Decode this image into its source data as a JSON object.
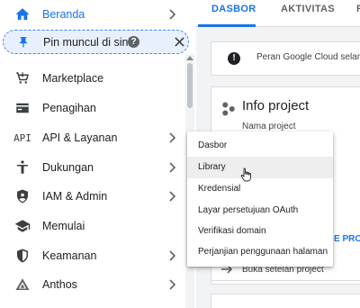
{
  "nav": {
    "items": [
      {
        "label": "Beranda",
        "icon": "home-icon"
      },
      {
        "label": "Marketplace",
        "icon": "cart-icon"
      },
      {
        "label": "Penagihan",
        "icon": "billing-icon"
      },
      {
        "label": "API & Layanan",
        "icon": "api-icon",
        "icon_text": "API"
      },
      {
        "label": "Dukungan",
        "icon": "support-person-icon"
      },
      {
        "label": "IAM & Admin",
        "icon": "shield-person-icon"
      },
      {
        "label": "Memulai",
        "icon": "graduation-cap-icon"
      },
      {
        "label": "Keamanan",
        "icon": "security-shield-icon"
      },
      {
        "label": "Anthos",
        "icon": "anthos-icon"
      }
    ],
    "pin": {
      "label": "Pin muncul di sini",
      "help_icon": "help-icon",
      "close_icon": "close-icon"
    }
  },
  "tabs": [
    {
      "label": "DASBOR",
      "active": true
    },
    {
      "label": "AKTIVITAS",
      "active": false
    },
    {
      "label": "R",
      "active": false
    }
  ],
  "banner": {
    "icon_text": "!",
    "text": "Peran Google Cloud selama"
  },
  "info_card": {
    "title": "Info project",
    "subtitle": "Nama project",
    "link": "E PROJ",
    "footer": "Buka setelan project"
  },
  "submenu": {
    "items": [
      {
        "label": "Dasbor"
      },
      {
        "label": "Library"
      },
      {
        "label": "Kredensial"
      },
      {
        "label": "Layar persetujuan OAuth"
      },
      {
        "label": "Verifikasi domain"
      },
      {
        "label": "Perjanjian penggunaan halaman"
      }
    ],
    "hovered_index": 1
  },
  "colors": {
    "accent": "#1a73e8",
    "pin_bg": "#e8f0fe",
    "content_bg": "#f1f3f4"
  }
}
